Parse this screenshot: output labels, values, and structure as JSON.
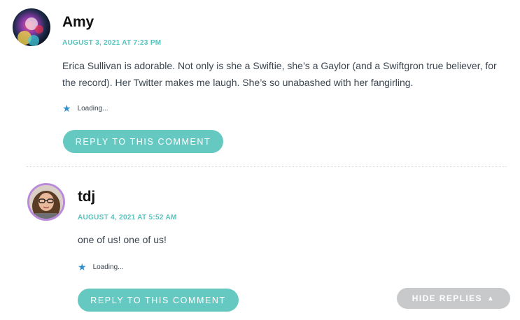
{
  "comments": [
    {
      "author": "Amy",
      "date": "AUGUST 3, 2021 AT 7:23 PM",
      "text": "Erica Sullivan is adorable. Not only is she a Swiftie, she’s a Gaylor (and a Swiftgron true believer, for the record). Her Twitter makes me laugh. She’s so unabashed with her fangirling.",
      "like_status": "Loading...",
      "reply_label": "REPLY TO THIS COMMENT"
    },
    {
      "author": "tdj",
      "date": "AUGUST 4, 2021 AT 5:52 AM",
      "text": "one of us! one of us!",
      "like_status": "Loading...",
      "reply_label": "REPLY TO THIS COMMENT"
    }
  ],
  "hide_replies_label": "HIDE REPLIES",
  "icons": {
    "like": "star-icon",
    "hide_replies": "triangle-up-icon"
  },
  "colors": {
    "accent": "#65c9c2",
    "date": "#55c3bb",
    "star": "#2f8fd0",
    "hide_replies_bg": "#c8c9cb",
    "avatar_ring": "#b98ad9"
  }
}
